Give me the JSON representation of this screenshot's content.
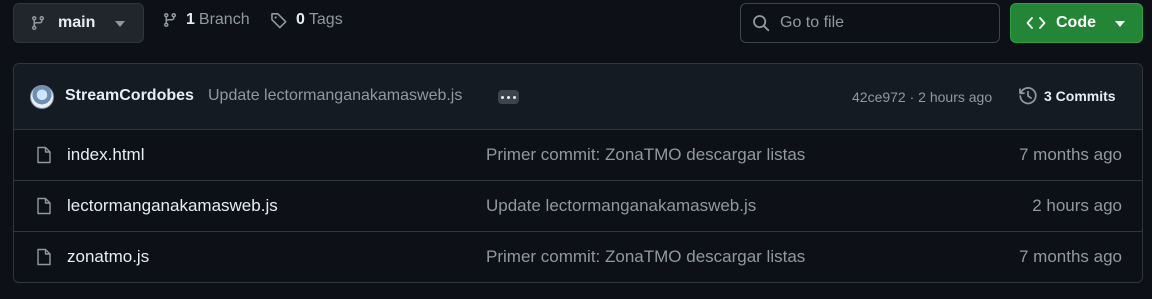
{
  "toolbar": {
    "branch_name": "main",
    "branch_count": "1",
    "branch_label": "Branch",
    "tag_count": "0",
    "tag_label": "Tags",
    "search_placeholder": "Go to file",
    "code_label": "Code"
  },
  "latest_commit": {
    "author": "StreamCordobes",
    "message": "Update lectormanganakamasweb.js",
    "sha_time": "42ce972 · 2 hours ago",
    "commits_label": "3 Commits"
  },
  "files": [
    {
      "name": "index.html",
      "message": "Primer commit: ZonaTMO descargar listas",
      "time": "7 months ago"
    },
    {
      "name": "lectormanganakamasweb.js",
      "message": "Update lectormanganakamasweb.js",
      "time": "2 hours ago"
    },
    {
      "name": "zonatmo.js",
      "message": "Primer commit: ZonaTMO descargar listas",
      "time": "7 months ago"
    }
  ],
  "icons": {
    "branch": "git-branch-icon",
    "tag": "tag-icon",
    "search": "search-icon",
    "code": "code-icon",
    "history": "history-icon",
    "file": "file-icon"
  },
  "colors": {
    "background": "#0d1117",
    "code_button": "#238636",
    "muted_text": "#9198a1"
  }
}
